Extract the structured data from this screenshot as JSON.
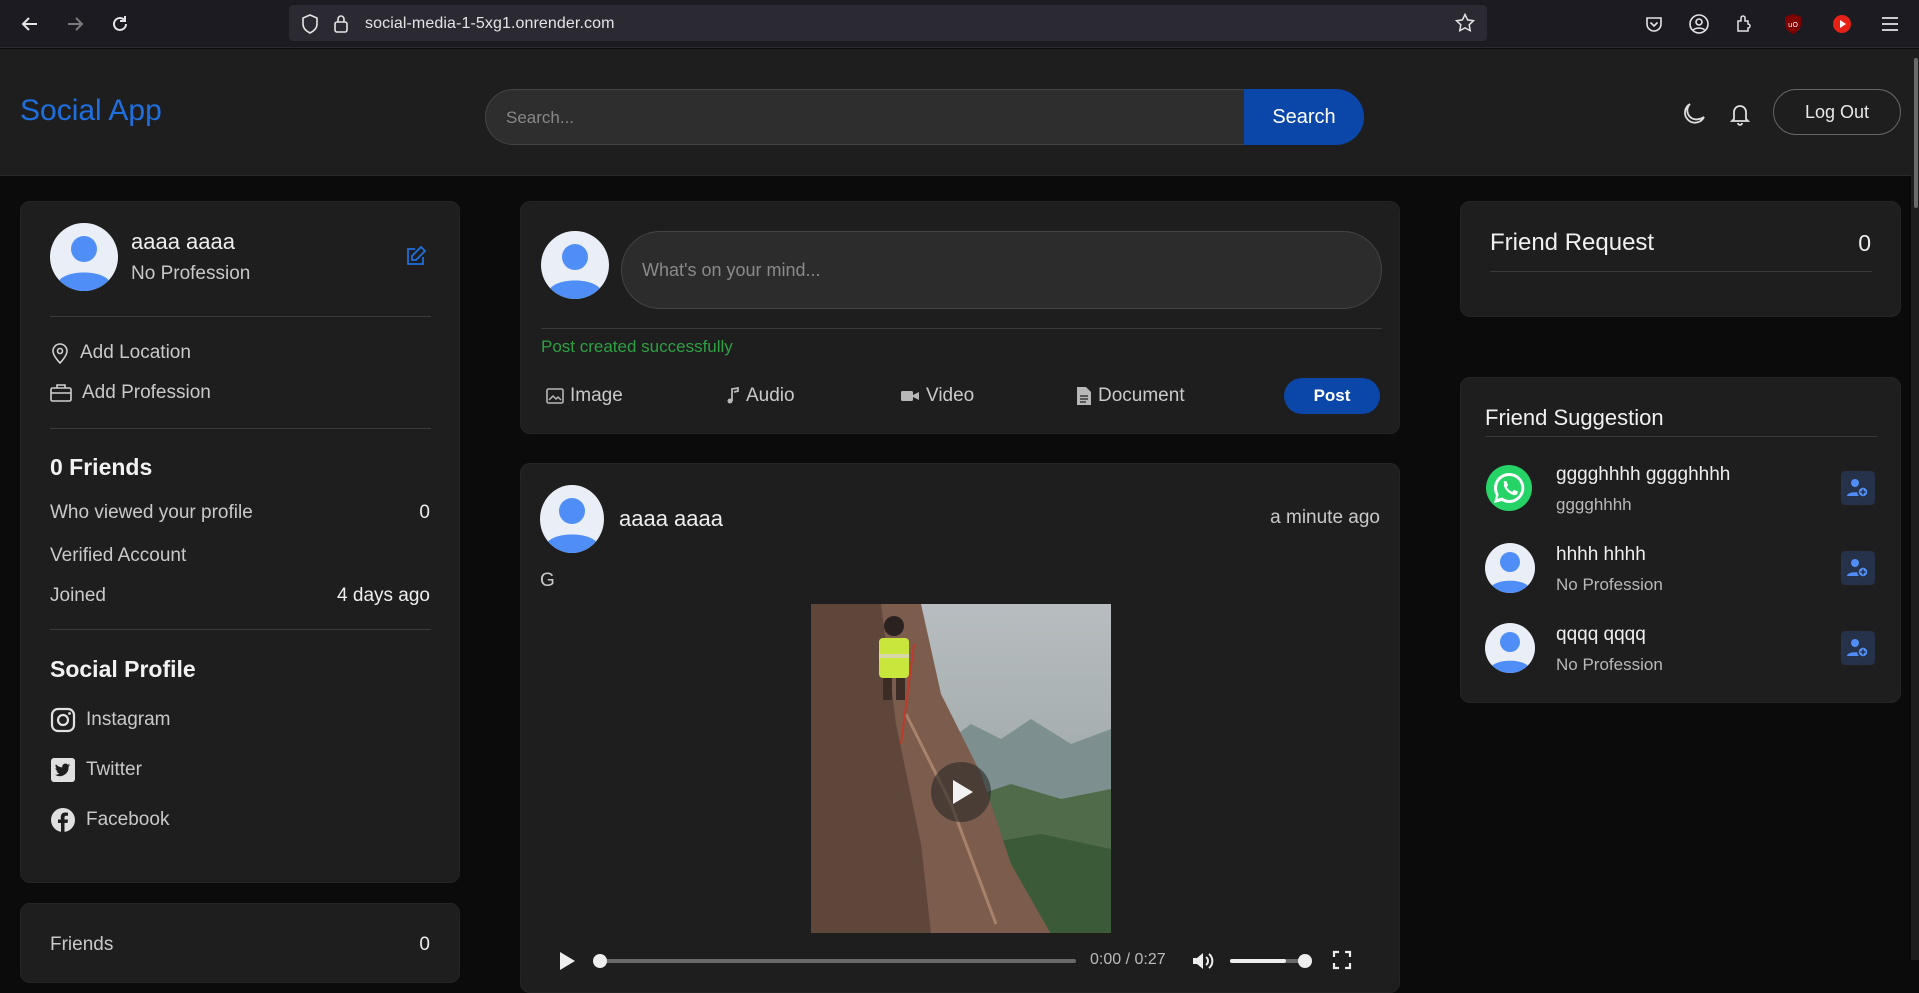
{
  "browser": {
    "url": "social-media-1-5xg1.onrender.com"
  },
  "header": {
    "brand": "Social App",
    "search_placeholder": "Search...",
    "search_button": "Search",
    "logout_button": "Log Out"
  },
  "profile": {
    "name": "aaaa aaaa",
    "profession": "No Profession",
    "add_location": "Add Location",
    "add_profession": "Add Profession",
    "friends_count_label": "0 Friends",
    "stats": [
      {
        "label": "Who viewed your profile",
        "value": "0"
      },
      {
        "label": "Verified Account",
        "value": ""
      },
      {
        "label": "Joined",
        "value": "4 days ago"
      }
    ],
    "social_title": "Social Profile",
    "social_links": [
      {
        "label": "Instagram",
        "icon": "instagram-icon"
      },
      {
        "label": "Twitter",
        "icon": "twitter-icon"
      },
      {
        "label": "Facebook",
        "icon": "facebook-icon"
      }
    ]
  },
  "friends_card": {
    "label": "Friends",
    "value": "0"
  },
  "composer": {
    "placeholder": "What's on your mind...",
    "status": "Post created successfully",
    "actions": [
      "Image",
      "Audio",
      "Video",
      "Document"
    ],
    "post_button": "Post"
  },
  "post": {
    "author": "aaaa aaaa",
    "time": "a minute ago",
    "text": "G",
    "video_time": "0:00 / 0:27",
    "volume_level": 0.8
  },
  "friend_request": {
    "title": "Friend Request",
    "count": "0"
  },
  "friend_suggestion": {
    "title": "Friend Suggestion",
    "items": [
      {
        "name": "gggghhhh gggghhhh",
        "profession": "gggghhhh",
        "avatar": "whatsapp-icon"
      },
      {
        "name": "hhhh hhhh",
        "profession": "No Profession",
        "avatar": "default-avatar"
      },
      {
        "name": "qqqq qqqq",
        "profession": "No Profession",
        "avatar": "default-avatar"
      }
    ]
  },
  "colors": {
    "accent": "#0b47a8",
    "brand": "#1f6fde",
    "success": "#2ea043",
    "card": "#1e1e1e",
    "page": "#0b0b0b"
  }
}
